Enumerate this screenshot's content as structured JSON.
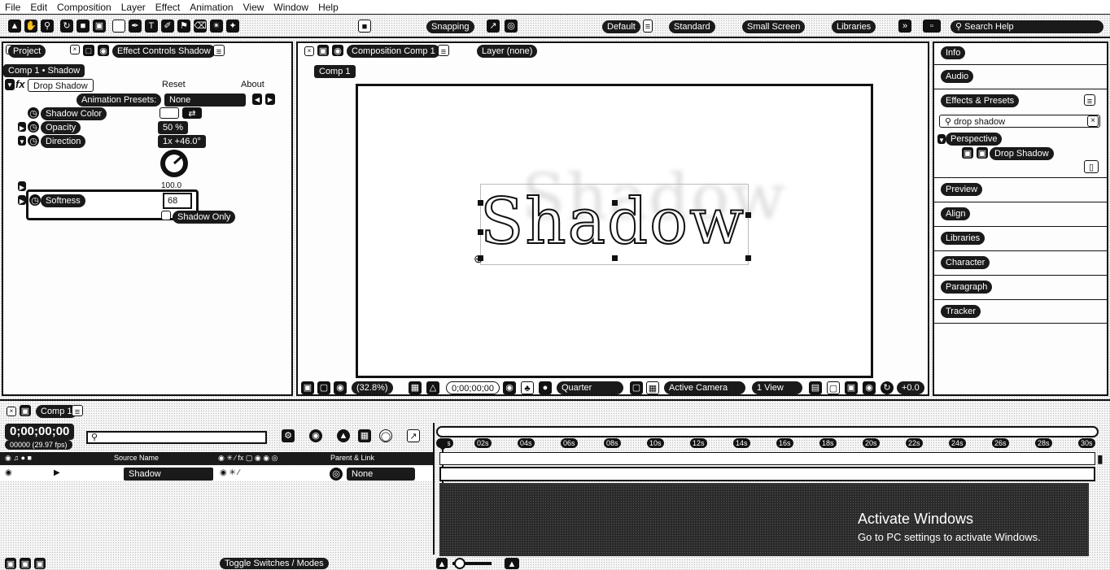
{
  "menu": [
    "File",
    "Edit",
    "Composition",
    "Layer",
    "Effect",
    "Animation",
    "View",
    "Window",
    "Help"
  ],
  "toolbar": {
    "snapping": "Snapping",
    "workspaces": [
      "Default",
      "Standard",
      "Small Screen",
      "Libraries"
    ],
    "search_help": "Search Help"
  },
  "left_panel": {
    "tab_project": "Project",
    "tab_effect_controls": "Effect Controls Shadow",
    "breadcrumb": "Comp 1 • Shadow",
    "effect_name": "Drop Shadow",
    "reset": "Reset",
    "about": "About",
    "animation_presets_label": "Animation Presets:",
    "animation_presets_value": "None",
    "props": {
      "shadow_color": "Shadow Color",
      "opacity": "Opacity",
      "opacity_value": "50 %",
      "direction": "Direction",
      "direction_value": "1x +46.0°",
      "distance_value": "100.0",
      "softness": "Softness",
      "softness_value": "68",
      "shadow_only": "Shadow Only"
    }
  },
  "comp_panel": {
    "tab_composition": "Composition Comp 1",
    "layer_label": "Layer (none)",
    "comp_tag": "Comp 1",
    "canvas_text": "Shadow",
    "footer": {
      "zoom": "(32.8%)",
      "timecode": "0;00;00;00",
      "resolution": "Quarter",
      "camera": "Active Camera",
      "view": "1 View",
      "exposure": "+0.0"
    }
  },
  "right_panel": {
    "info": "Info",
    "audio": "Audio",
    "effects_presets": "Effects & Presets",
    "search_value": "drop shadow",
    "category": "Perspective",
    "result": "Drop Shadow",
    "sections": [
      "Preview",
      "Align",
      "Libraries",
      "Character",
      "Paragraph",
      "Tracker"
    ]
  },
  "timeline": {
    "tab": "Comp 1",
    "timecode": "0;00;00;00",
    "frames": "00000 (29.97 fps)",
    "source_name_header": "Source Name",
    "parent_header": "Parent & Link",
    "layer_name": "Shadow",
    "parent_value": "None",
    "ticks": [
      "00s",
      "02s",
      "04s",
      "06s",
      "08s",
      "10s",
      "12s",
      "14s",
      "16s",
      "18s",
      "20s",
      "22s",
      "24s",
      "26s",
      "28s",
      "30s"
    ],
    "toggle": "Toggle Switches / Modes"
  },
  "watermark": {
    "title": "Activate Windows",
    "subtitle": "Go to PC settings to activate Windows."
  }
}
